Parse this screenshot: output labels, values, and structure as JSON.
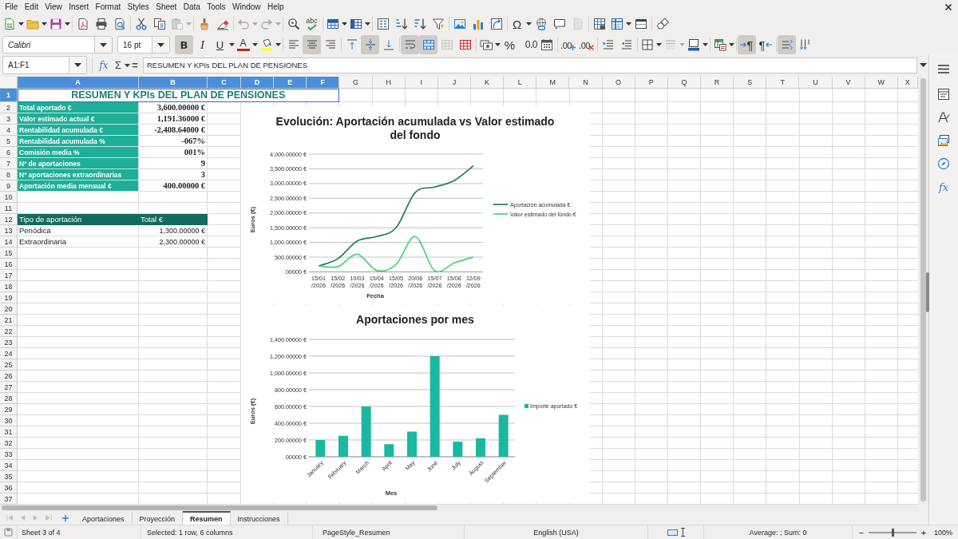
{
  "menu_bar": {
    "menus": [
      "File",
      "Edit",
      "View",
      "Insert",
      "Format",
      "Styles",
      "Sheet",
      "Data",
      "Tools",
      "Window",
      "Help"
    ]
  },
  "standard_toolbar": {
    "groups": [
      [
        {
          "kind": "new",
          "has_menu": true,
          "disabled": false
        },
        {
          "kind": "open",
          "has_menu": true,
          "disabled": false
        },
        {
          "kind": "save",
          "has_menu": true,
          "disabled": false
        }
      ],
      [
        {
          "kind": "export_pdf",
          "disabled": false
        },
        {
          "kind": "print",
          "disabled": false
        },
        {
          "kind": "print_preview",
          "disabled": false
        }
      ],
      [
        {
          "kind": "cut",
          "disabled": false
        },
        {
          "kind": "copy",
          "disabled": false
        },
        {
          "kind": "paste",
          "has_menu": true,
          "disabled": true
        }
      ],
      [
        {
          "kind": "clone_formatting",
          "disabled": false
        },
        {
          "kind": "clear_formatting",
          "disabled": false
        }
      ],
      [
        {
          "kind": "undo",
          "has_menu": true,
          "disabled": true
        },
        {
          "kind": "redo",
          "has_menu": true,
          "disabled": true
        }
      ],
      [
        {
          "kind": "find_replace",
          "disabled": false
        },
        {
          "kind": "spelling",
          "glyph": "abc",
          "disabled": false
        }
      ],
      [
        {
          "kind": "row",
          "has_menu": true,
          "disabled": false
        },
        {
          "kind": "column",
          "has_menu": true,
          "disabled": false
        }
      ],
      [
        {
          "kind": "sort",
          "disabled": false
        },
        {
          "kind": "sort_ascending",
          "disabled": false
        },
        {
          "kind": "sort_descending",
          "disabled": false
        },
        {
          "kind": "autofilter",
          "disabled": false
        }
      ],
      [
        {
          "kind": "image",
          "disabled": false
        },
        {
          "kind": "chart",
          "disabled": false
        },
        {
          "kind": "pivot_table",
          "disabled": false
        }
      ],
      [
        {
          "kind": "special_character",
          "glyph": "Ω",
          "has_menu": true,
          "disabled": false
        },
        {
          "kind": "hyperlink",
          "disabled": false
        },
        {
          "kind": "comment",
          "disabled": false
        },
        {
          "kind": "headers_footers",
          "disabled": true
        }
      ],
      [
        {
          "kind": "print_area",
          "disabled": false
        },
        {
          "kind": "freeze",
          "has_menu": true,
          "disabled": false
        },
        {
          "kind": "split_window",
          "disabled": false
        }
      ],
      [
        {
          "kind": "draw_functions",
          "disabled": false
        }
      ]
    ]
  },
  "formatting_toolbar": {
    "font_name": "Calibri",
    "font_size": "16 pt",
    "groups": [
      [
        {
          "kind": "bold",
          "glyph": "B",
          "on": true,
          "disabled": false
        },
        {
          "kind": "italic",
          "glyph": "I",
          "on": false,
          "disabled": false
        },
        {
          "kind": "underline",
          "glyph": "U",
          "has_menu": true,
          "on": false,
          "disabled": false
        },
        {
          "kind": "font_color",
          "glyph": "A",
          "has_menu": true,
          "on": false,
          "disabled": false
        },
        {
          "kind": "highlighting",
          "has_menu": true,
          "on": false,
          "disabled": false
        }
      ],
      [
        {
          "kind": "align_left",
          "on": false,
          "disabled": false
        },
        {
          "kind": "align_center",
          "on": true,
          "disabled": false
        },
        {
          "kind": "align_right",
          "on": false,
          "disabled": false
        }
      ],
      [
        {
          "kind": "align_top",
          "on": false,
          "disabled": false
        },
        {
          "kind": "align_middle",
          "on": true,
          "disabled": false
        },
        {
          "kind": "align_bottom",
          "on": false,
          "disabled": false
        }
      ],
      [
        {
          "kind": "wrap_text",
          "on": true,
          "disabled": false
        },
        {
          "kind": "merge_center",
          "on": true,
          "disabled": false
        },
        {
          "kind": "unmerge",
          "on": false,
          "disabled": true
        },
        {
          "kind": "merge",
          "on": false,
          "disabled": false
        }
      ],
      [
        {
          "kind": "currency",
          "has_menu": true,
          "on": false,
          "disabled": false
        },
        {
          "kind": "percent",
          "glyph": "%",
          "on": false,
          "disabled": false
        },
        {
          "kind": "number",
          "glyph": "0.0",
          "on": false,
          "disabled": false
        },
        {
          "kind": "date",
          "on": false,
          "disabled": false
        }
      ],
      [
        {
          "kind": "add_decimal",
          "glyph": ".00",
          "on": false,
          "disabled": false
        },
        {
          "kind": "delete_decimal",
          "glyph": ".00",
          "on": false,
          "disabled": false
        }
      ],
      [
        {
          "kind": "increase_indent",
          "on": false,
          "disabled": false
        },
        {
          "kind": "decrease_indent",
          "on": false,
          "disabled": false
        }
      ],
      [
        {
          "kind": "borders",
          "has_menu": true,
          "on": false,
          "disabled": false
        },
        {
          "kind": "border_style",
          "has_menu": true,
          "on": false,
          "disabled": true
        },
        {
          "kind": "border_color",
          "has_menu": true,
          "on": false,
          "disabled": false
        }
      ],
      [
        {
          "kind": "conditional",
          "has_menu": true,
          "on": false,
          "disabled": false
        }
      ],
      [
        {
          "kind": "left_to_right",
          "glyph": "¶",
          "on": true,
          "disabled": false
        },
        {
          "kind": "right_to_left",
          "glyph": "¶",
          "on": false,
          "disabled": false
        }
      ],
      [
        {
          "kind": "text_left_right",
          "on": true,
          "disabled": false
        },
        {
          "kind": "text_top_bottom",
          "on": false,
          "disabled": false
        }
      ]
    ]
  },
  "formula_bar": {
    "name_box": "A1:F1",
    "function_glyph": "fx",
    "sum_glyph": "Σ",
    "equals_glyph": "=",
    "content": "RESUMEN Y KPIs DEL PLAN DE PENSIONES"
  },
  "sidebar": {
    "tabs": [
      {
        "kind": "properties",
        "selected": false
      },
      {
        "kind": "styles",
        "selected": false
      },
      {
        "kind": "gallery",
        "selected": false
      },
      {
        "kind": "navigator",
        "selected": false
      },
      {
        "kind": "functions",
        "glyph": "fx",
        "selected": false
      }
    ]
  },
  "sheet": {
    "column_headers": [
      {
        "label": "A",
        "selected": true
      },
      {
        "label": "B",
        "selected": true
      },
      {
        "label": "C",
        "selected": true
      },
      {
        "label": "D",
        "selected": true
      },
      {
        "label": "E",
        "selected": true
      },
      {
        "label": "F",
        "selected": true
      },
      {
        "label": "G",
        "selected": false
      },
      {
        "label": "H",
        "selected": false
      },
      {
        "label": "I",
        "selected": false
      },
      {
        "label": "J",
        "selected": false
      },
      {
        "label": "K",
        "selected": false
      },
      {
        "label": "L",
        "selected": false
      },
      {
        "label": "M",
        "selected": false
      },
      {
        "label": "N",
        "selected": false
      },
      {
        "label": "O",
        "selected": false
      },
      {
        "label": "P",
        "selected": false
      },
      {
        "label": "Q",
        "selected": false
      },
      {
        "label": "R",
        "selected": false
      },
      {
        "label": "S",
        "selected": false
      },
      {
        "label": "T",
        "selected": false
      },
      {
        "label": "U",
        "selected": false
      },
      {
        "label": "V",
        "selected": false
      },
      {
        "label": "W",
        "selected": false
      },
      {
        "label": "X",
        "selected": false
      }
    ],
    "rows": [
      {
        "header": "1",
        "selected": true,
        "cells": [
          {
            "kind": "title",
            "text": "RESUMEN Y KPIs DEL PLAN DE PENSIONES",
            "selected": true
          }
        ]
      },
      {
        "header": "2",
        "selected": false,
        "cells": [
          {
            "kind": "kpi_label",
            "text": "Total aportado €",
            "selected": false
          },
          {
            "kind": "kpi_value",
            "text": "3,600.00000 €",
            "selected": false
          }
        ]
      },
      {
        "header": "3",
        "selected": false,
        "cells": [
          {
            "kind": "kpi_label",
            "text": "Valor estimado actual €",
            "selected": false
          },
          {
            "kind": "kpi_value",
            "text": "1,191.36000 €",
            "selected": false
          }
        ]
      },
      {
        "header": "4",
        "selected": false,
        "cells": [
          {
            "kind": "kpi_label",
            "text": "Rentabilidad acumulada €",
            "selected": false
          },
          {
            "kind": "kpi_value",
            "text": "-2,408.64000 €",
            "selected": false
          }
        ]
      },
      {
        "header": "5",
        "selected": false,
        "cells": [
          {
            "kind": "kpi_label",
            "text": "Rentabilidad acumulada %",
            "selected": false
          },
          {
            "kind": "kpi_value",
            "text": "-067%",
            "selected": false
          }
        ]
      },
      {
        "header": "6",
        "selected": false,
        "cells": [
          {
            "kind": "kpi_label",
            "text": "Comisión media %",
            "selected": false
          },
          {
            "kind": "kpi_value",
            "text": "001%",
            "selected": false
          }
        ]
      },
      {
        "header": "7",
        "selected": false,
        "cells": [
          {
            "kind": "kpi_label",
            "text": "Nº de aportaciones",
            "selected": false
          },
          {
            "kind": "kpi_value",
            "text": "9",
            "selected": false
          }
        ]
      },
      {
        "header": "8",
        "selected": false,
        "cells": [
          {
            "kind": "kpi_label",
            "text": "Nº aportaciones extraordinarias",
            "selected": false
          },
          {
            "kind": "kpi_value",
            "text": "3",
            "selected": false
          }
        ]
      },
      {
        "header": "9",
        "selected": false,
        "cells": [
          {
            "kind": "kpi_label",
            "text": "Aportación media mensual €",
            "selected": false
          },
          {
            "kind": "kpi_value",
            "text": "400.00000 €",
            "selected": false
          }
        ]
      },
      {
        "header": "10",
        "selected": false
      },
      {
        "header": "11",
        "selected": false
      },
      {
        "header": "12",
        "selected": false,
        "cells": [
          {
            "kind": "table_header",
            "text": "Tipo de aportación",
            "selected": false
          },
          {
            "kind": "table_header",
            "text": "Total €",
            "selected": false
          }
        ]
      },
      {
        "header": "13",
        "selected": false,
        "cells": [
          {
            "kind": "text",
            "text": "Periódica",
            "selected": false
          },
          {
            "kind": "number",
            "text": "1,300.00000 €",
            "selected": false
          }
        ]
      },
      {
        "header": "14",
        "selected": false,
        "cells": [
          {
            "kind": "text",
            "text": "Extraordinaria",
            "selected": false
          },
          {
            "kind": "number",
            "text": "2,300.00000 €",
            "selected": false
          }
        ]
      },
      {
        "header": "15",
        "selected": false
      },
      {
        "header": "16",
        "selected": false
      },
      {
        "header": "17",
        "selected": false
      },
      {
        "header": "18",
        "selected": false
      },
      {
        "header": "19",
        "selected": false
      },
      {
        "header": "20",
        "selected": false
      },
      {
        "header": "21",
        "selected": false
      },
      {
        "header": "22",
        "selected": false
      },
      {
        "header": "23",
        "selected": false
      },
      {
        "header": "24",
        "selected": false
      },
      {
        "header": "25",
        "selected": false
      },
      {
        "header": "26",
        "selected": false
      },
      {
        "header": "27",
        "selected": false
      },
      {
        "header": "28",
        "selected": false
      },
      {
        "header": "29",
        "selected": false
      },
      {
        "header": "30",
        "selected": false
      },
      {
        "header": "31",
        "selected": false
      },
      {
        "header": "32",
        "selected": false
      },
      {
        "header": "33",
        "selected": false
      },
      {
        "header": "34",
        "selected": false
      },
      {
        "header": "35",
        "selected": false
      },
      {
        "header": "36",
        "selected": false
      },
      {
        "header": "37",
        "selected": false
      }
    ]
  },
  "charts": [
    {
      "chart_data": {
        "type": "line",
        "title": "Evolución: Aportación acumulada vs Valor estimado del fondo",
        "xlabel": "Fecha",
        "ylabel": "Euros (€)",
        "categories": [
          "15/01/2026",
          "15/02/2026",
          "10/03/2026",
          "15/04/2026",
          "15/05/2026",
          "20/06/2026",
          "15/07/2026",
          "15/08/2026",
          "12/09/2026"
        ],
        "series": [
          {
            "name": "Aportación acumulada €",
            "color": "#1f7a63",
            "values": [
              200,
              450,
              1050,
              1200,
              1500,
              2700,
              2880,
              3100,
              3600
            ]
          },
          {
            "name": "Valor estimado del fondo €",
            "color": "#4cd07d",
            "values": [
              200,
              180,
              600,
              50,
              250,
              1200,
              40,
              300,
              500
            ]
          }
        ],
        "ylim": [
          0,
          4000
        ],
        "yticks": [
          {
            "value": 0,
            "label": ".00000 €"
          },
          {
            "value": 500,
            "label": "500.00000 €"
          },
          {
            "value": 1000,
            "label": "1,000.00000 €"
          },
          {
            "value": 1500,
            "label": "1,500.00000 €"
          },
          {
            "value": 2000,
            "label": "2,000.00000 €"
          },
          {
            "value": 2500,
            "label": "2,500.00000 €"
          },
          {
            "value": 3000,
            "label": "3,000.00000 €"
          },
          {
            "value": 3500,
            "label": "3,500.00000 €"
          },
          {
            "value": 4000,
            "label": "4,000.00000 €"
          }
        ],
        "grid": true,
        "legend": "right"
      }
    },
    {
      "chart_data": {
        "type": "bar",
        "title": "Aportaciones por mes",
        "xlabel": "Mes",
        "ylabel": "Euros (€)",
        "categories": [
          "January",
          "February",
          "March",
          "April",
          "May",
          "June",
          "July",
          "August",
          "September"
        ],
        "series": [
          {
            "name": "Importe aportado €",
            "color": "#1ab8a2",
            "values": [
              200,
              250,
              600,
              150,
              300,
              1200,
              180,
              220,
              500
            ]
          }
        ],
        "ylim": [
          0,
          1400
        ],
        "yticks": [
          {
            "value": 0,
            "label": ".00000 €"
          },
          {
            "value": 200,
            "label": "200.00000 €"
          },
          {
            "value": 400,
            "label": "400.00000 €"
          },
          {
            "value": 600,
            "label": "600.00000 €"
          },
          {
            "value": 800,
            "label": "800.00000 €"
          },
          {
            "value": 1000,
            "label": "1,000.00000 €"
          },
          {
            "value": 1200,
            "label": "1,200.00000 €"
          },
          {
            "value": 1400,
            "label": "1,400.00000 €"
          }
        ],
        "grid": true,
        "legend": "right"
      }
    }
  ],
  "sheet_tabs": {
    "navigation": [
      {
        "kind": "first",
        "disabled": true
      },
      {
        "kind": "previous",
        "disabled": true
      },
      {
        "kind": "next",
        "disabled": true
      },
      {
        "kind": "last",
        "disabled": true
      }
    ],
    "tabs": [
      {
        "label": "Aportaciones",
        "selected": false
      },
      {
        "label": "Proyección",
        "selected": false
      },
      {
        "label": "Resumen",
        "selected": true
      },
      {
        "label": "Instrucciones",
        "selected": false
      }
    ]
  },
  "status_bar": {
    "sheet": "Sheet 3 of 4",
    "selection": "Selected: 1 row, 6 columns",
    "page_style": "PageStyle_Resumen",
    "language": "English (USA)",
    "summary": "Average: ; Sum: 0",
    "zoom_out": "−",
    "zoom": {
      "level": 0.5
    },
    "zoom_in": "+",
    "zoom_percent": "100%"
  }
}
